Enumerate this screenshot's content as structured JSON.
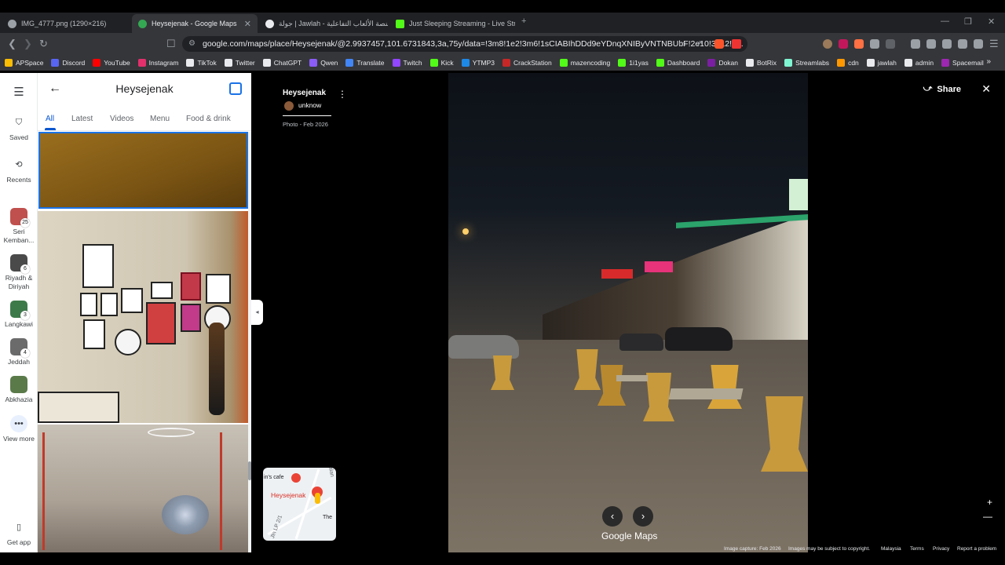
{
  "browser": {
    "tabs": [
      {
        "title": "IMG_4777.png (1290×216)",
        "active": false,
        "color": "#9aa0a6"
      },
      {
        "title": "Heysejenak - Google Maps",
        "active": true,
        "color": "#34a853"
      },
      {
        "title": "جولة | Jawlah - منصة الألعاب التفاعلية",
        "active": false,
        "color": "#e8eaed"
      },
      {
        "title": "Just Sleeping Streaming - Live Stream",
        "active": false,
        "color": "#53fc18"
      }
    ],
    "url": "google.com/maps/place/Heysejenak/@2.9937457,101.6731843,3a,75y/data=!3m8!1e2!3m6!1sCIABIhDDd9eYDnqXNIByVNTNBUbF!2e10!3e12!6...",
    "bookmarks": [
      {
        "label": "APSpace",
        "color": "#fbbc04"
      },
      {
        "label": "Discord",
        "color": "#5865f2"
      },
      {
        "label": "YouTube",
        "color": "#ff0000"
      },
      {
        "label": "Instagram",
        "color": "#e1306c"
      },
      {
        "label": "TikTok",
        "color": "#e8eaed"
      },
      {
        "label": "Twitter",
        "color": "#e8eaed"
      },
      {
        "label": "ChatGPT",
        "color": "#e8eaed"
      },
      {
        "label": "Qwen",
        "color": "#8b5cf6"
      },
      {
        "label": "Translate",
        "color": "#4285f4"
      },
      {
        "label": "Twitch",
        "color": "#9146ff"
      },
      {
        "label": "Kick",
        "color": "#53fc18"
      },
      {
        "label": "YTMP3",
        "color": "#1e88e5"
      },
      {
        "label": "CrackStation",
        "color": "#c62828"
      },
      {
        "label": "mazencoding",
        "color": "#53fc18"
      },
      {
        "label": "1i1yas",
        "color": "#53fc18"
      },
      {
        "label": "Dashboard",
        "color": "#53fc18"
      },
      {
        "label": "Dokan",
        "color": "#7b1fa2"
      },
      {
        "label": "BotRix",
        "color": "#e8eaed"
      },
      {
        "label": "Streamlabs",
        "color": "#80f5d2"
      },
      {
        "label": "cdn",
        "color": "#ff9800"
      },
      {
        "label": "jawlah",
        "color": "#e8eaed"
      },
      {
        "label": "admin",
        "color": "#e8eaed"
      },
      {
        "label": "Spacemail",
        "color": "#9c27b0"
      }
    ]
  },
  "rail": {
    "saved": "Saved",
    "recents": "Recents",
    "trips": [
      {
        "label": "Seri Kemban...",
        "count": "25",
        "color": "#c0504d"
      },
      {
        "label": "Riyadh & Diriyah",
        "count": "6",
        "color": "#4a4a4a"
      },
      {
        "label": "Langkawi",
        "count": "3",
        "color": "#3d7a4a"
      },
      {
        "label": "Jeddah",
        "count": "4",
        "color": "#6b6b6b"
      },
      {
        "label": "Abkhazia",
        "count": "",
        "color": "#5a7a4a"
      }
    ],
    "view_more": "View more",
    "get_app": "Get app"
  },
  "panel": {
    "title": "Heysejenak",
    "tabs": [
      "All",
      "Latest",
      "Videos",
      "Menu",
      "Food & drink"
    ],
    "active_tab": "All"
  },
  "viewer": {
    "place": "Heysejenak",
    "user": "unknow",
    "date": "Photo - Feb 2026",
    "share": "Share",
    "brand": "Google Maps",
    "minimap": {
      "place": "Heysejenak",
      "cafe": "in's cafe",
      "road": "Jln LP 2/1",
      "jalan": "Jalan",
      "the": "The"
    },
    "footer": [
      "Image capture: Feb 2026",
      "Images may be subject to copyright.",
      "Malaysia",
      "Terms",
      "Privacy",
      "Report a problem"
    ]
  }
}
